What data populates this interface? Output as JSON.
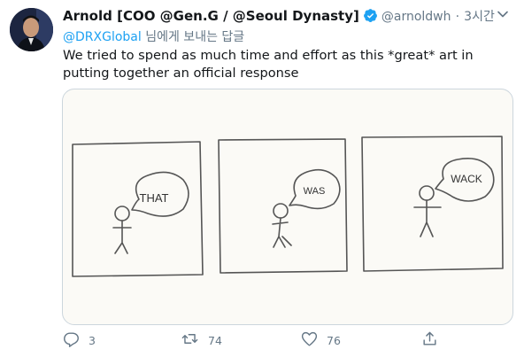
{
  "tweet": {
    "author_name": "Arnold [COO @Gen.G / @Seoul Dynasty]",
    "handle": "@arnoldwh",
    "separator": "·",
    "time": "3시간",
    "reply_mention": "@DRXGlobal",
    "reply_suffix": "님에게 보내는 답글",
    "text": "We tried to spend as much time and effort as this *great* art in putting together an official response"
  },
  "comic": {
    "panels": [
      {
        "bubble_text": "THAT"
      },
      {
        "bubble_text": "WAS"
      },
      {
        "bubble_text": "WACK"
      }
    ]
  },
  "actions": {
    "reply_count": "3",
    "retweet_count": "74",
    "like_count": "76"
  },
  "icons": [
    "avatar",
    "verified-badge-icon",
    "more-icon",
    "reply-icon",
    "retweet-icon",
    "like-icon",
    "share-icon"
  ],
  "colors": {
    "accent": "#1da1f2",
    "muted": "#657786",
    "text": "#14171a"
  }
}
